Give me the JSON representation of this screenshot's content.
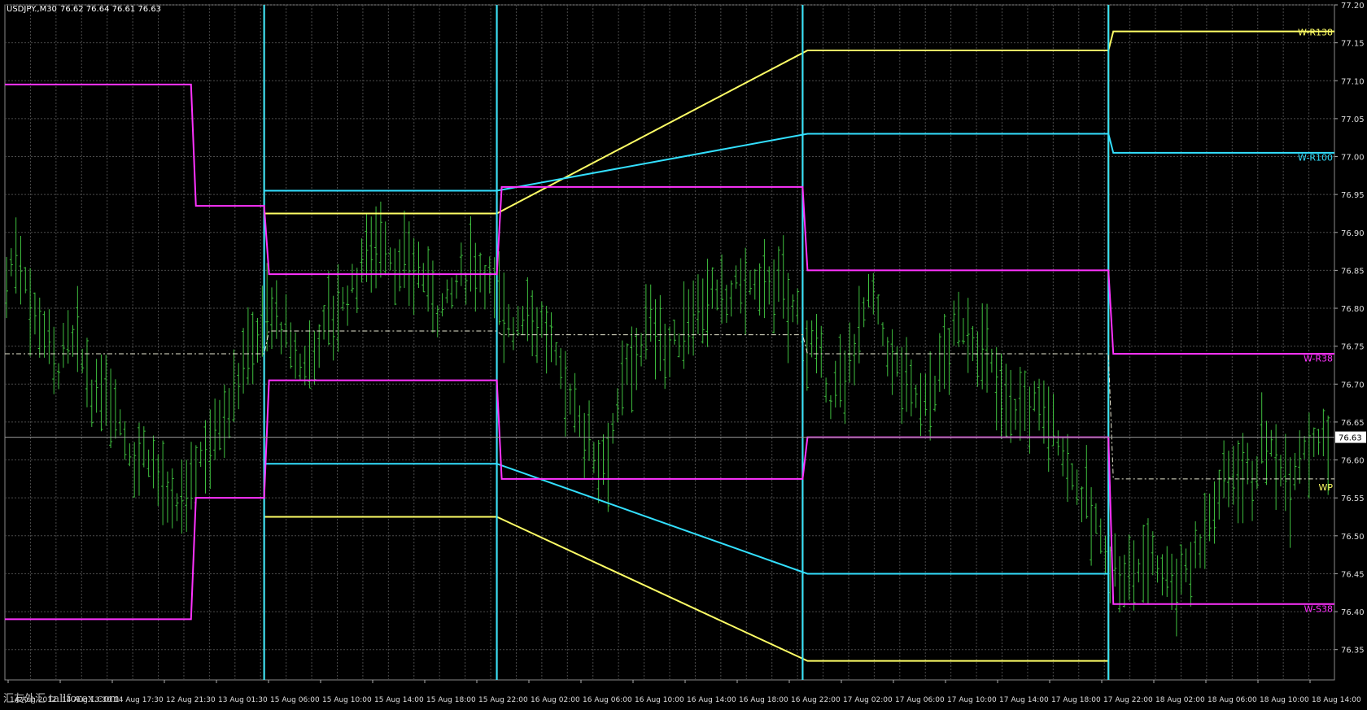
{
  "window": {
    "symbol_info": "USDJPY.,M30",
    "ohlc_text": "76.62 76.64 76.61 76.63"
  },
  "watermark": {
    "text": "汇友外汇 tallforex.com"
  },
  "colors": {
    "background": "#000000",
    "grid": "#4a4a4a",
    "candles": "#3fbf3f",
    "r138": "#ffff66",
    "r100": "#33e0ff",
    "r38": "#ff33ff",
    "pivot": "#e6e6d0",
    "axis_text": "#dcdcdc"
  },
  "chart_data": {
    "type": "line",
    "title": "USDJPY.,M30",
    "ylim": [
      76.31,
      77.2
    ],
    "y_ticks": [
      "77.20",
      "77.15",
      "77.10",
      "77.05",
      "77.00",
      "76.95",
      "76.90",
      "76.85",
      "76.80",
      "76.75",
      "76.70",
      "76.65",
      "76.60",
      "76.55",
      "76.50",
      "76.45",
      "76.40",
      "76.35"
    ],
    "x_tick_labels": [
      "14 Aug 2012",
      "14 Aug 13:30",
      "14 Aug 17:30",
      "12 Aug 21:30",
      "13 Aug 01:30",
      "15 Aug 06:00",
      "15 Aug 10:00",
      "15 Aug 14:00",
      "15 Aug 18:00",
      "15 Aug 22:00",
      "16 Aug 02:00",
      "16 Aug 06:00",
      "16 Aug 10:00",
      "16 Aug 14:00",
      "16 Aug 18:00",
      "16 Aug 22:00",
      "17 Aug 02:00",
      "17 Aug 06:00",
      "17 Aug 10:00",
      "17 Aug 14:00",
      "17 Aug 18:00",
      "17 Aug 22:00",
      "18 Aug 02:00",
      "18 Aug 06:00",
      "18 Aug 10:00",
      "18 Aug 14:00"
    ],
    "current_price": 76.63,
    "series": [
      {
        "name": "W-R138",
        "color": "#ffff66",
        "segments": [
          {
            "from": 0.195,
            "to": 0.37,
            "upper": 76.925,
            "lower": 76.525
          },
          {
            "from": 0.6,
            "to": 0.83,
            "upper": 77.14,
            "lower": 76.335
          },
          {
            "from": 0.83,
            "to": 1.0,
            "upper": 77.165,
            "lower": null
          }
        ]
      },
      {
        "name": "W-R100",
        "color": "#33e0ff",
        "segments": [
          {
            "from": 0.195,
            "to": 0.37,
            "upper": 76.955,
            "lower": 76.595
          },
          {
            "from": 0.6,
            "to": 0.83,
            "upper": 77.03,
            "lower": 76.45
          },
          {
            "from": 0.83,
            "to": 1.0,
            "upper": 77.005,
            "lower": null
          }
        ]
      },
      {
        "name": "W-R38 / W-S38",
        "color": "#ff33ff",
        "segments": [
          {
            "from": 0.0,
            "to": 0.14,
            "upper": 77.095,
            "lower": 76.39
          },
          {
            "from": 0.14,
            "to": 0.195,
            "upper": 76.935,
            "lower": 76.55
          },
          {
            "from": 0.195,
            "to": 0.37,
            "upper": 76.845,
            "lower": 76.705
          },
          {
            "from": 0.37,
            "to": 0.6,
            "upper": 76.96,
            "lower": 76.575
          },
          {
            "from": 0.6,
            "to": 0.83,
            "upper": 76.85,
            "lower": 76.63
          },
          {
            "from": 0.83,
            "to": 1.0,
            "upper": 76.74,
            "lower": 76.41
          }
        ]
      },
      {
        "name": "WP",
        "color": "#e6e6d0",
        "segments": [
          {
            "from": 0.0,
            "to": 0.195,
            "value": 76.74
          },
          {
            "from": 0.195,
            "to": 0.37,
            "value": 76.77
          },
          {
            "from": 0.37,
            "to": 0.6,
            "value": 76.765
          },
          {
            "from": 0.6,
            "to": 0.83,
            "value": 76.74
          },
          {
            "from": 0.83,
            "to": 1.0,
            "value": 76.575
          }
        ]
      }
    ],
    "right_labels": [
      {
        "text": "W-R138",
        "value": 77.165,
        "color": "#ffff66"
      },
      {
        "text": "W-R100",
        "value": 77.0,
        "color": "#33e0ff"
      },
      {
        "text": "W-R38",
        "value": 76.735,
        "color": "#ff33ff"
      },
      {
        "text": "WP",
        "value": 76.565,
        "color": "#ffff66"
      },
      {
        "text": "W-S38",
        "value": 76.405,
        "color": "#ff33ff"
      }
    ],
    "price_path": [
      76.84,
      76.88,
      76.8,
      76.78,
      76.72,
      76.76,
      76.73,
      76.67,
      76.7,
      76.65,
      76.6,
      76.62,
      76.58,
      76.52,
      76.55,
      76.6,
      76.63,
      76.66,
      76.7,
      76.74,
      76.78,
      76.8,
      76.76,
      76.72,
      76.74,
      76.78,
      76.8,
      76.82,
      76.86,
      76.9,
      76.88,
      76.84,
      76.86,
      76.84,
      76.8,
      76.82,
      76.84,
      76.86,
      76.84,
      76.8,
      76.78,
      76.8,
      76.78,
      76.74,
      76.7,
      76.66,
      76.62,
      76.6,
      76.66,
      76.72,
      76.76,
      76.78,
      76.74,
      76.76,
      76.8,
      76.82,
      76.8,
      76.82,
      76.84,
      76.82,
      76.84,
      76.82,
      76.8,
      76.76,
      76.72,
      76.68,
      76.7,
      76.78,
      76.82,
      76.76,
      76.72,
      76.7,
      76.68,
      76.7,
      76.74,
      76.78,
      76.76,
      76.74,
      76.7,
      76.68,
      76.66,
      76.68,
      76.66,
      76.62,
      76.58,
      76.54,
      76.5,
      76.46,
      76.44,
      76.46,
      76.48,
      76.46,
      76.44,
      76.46,
      76.5,
      76.54,
      76.58,
      76.6,
      76.58,
      76.62,
      76.6,
      76.58,
      76.62,
      76.64,
      76.62
    ]
  }
}
